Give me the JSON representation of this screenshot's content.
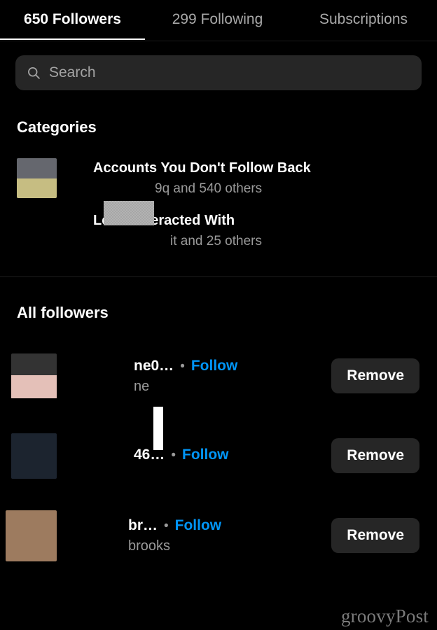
{
  "tabs": [
    {
      "label": "650 Followers",
      "active": true
    },
    {
      "label": "299 Following",
      "active": false
    },
    {
      "label": "Subscriptions",
      "active": false
    }
  ],
  "search": {
    "placeholder": "Search",
    "value": "",
    "icon": "search-icon"
  },
  "categories": {
    "title": "Categories",
    "items": [
      {
        "name": "Accounts You Don't Follow Back",
        "subtitle": "9q and 540 others",
        "avatar_top_color": "#65676e",
        "avatar_bottom_color": "#c6bd82"
      },
      {
        "name": "Least Interacted With",
        "subtitle": "it and 25 others",
        "avatar_top_color": "#65676e",
        "avatar_bottom_color": "#c6bd82"
      }
    ]
  },
  "all_followers": {
    "title": "All followers",
    "dot_separator": "•",
    "follow_label": "Follow",
    "remove_label": "Remove",
    "rows": [
      {
        "username": "ne0…",
        "fullname": "ne",
        "avatar_top_color": "#333333",
        "avatar_bottom_color": "#e4c0b8"
      },
      {
        "username": "46…",
        "fullname": "",
        "avatar_top_color": "#1c242f",
        "avatar_bottom_color": "#1c242f"
      },
      {
        "username": "br…",
        "fullname": "brooks",
        "avatar_top_color": "#9d7b5f",
        "avatar_bottom_color": "#9d7b5f"
      }
    ]
  },
  "watermark": "groovyPost",
  "colors": {
    "background": "#000000",
    "surface": "#262626",
    "accent_blue": "#0095f6",
    "text_primary": "#ffffff",
    "text_secondary": "#9a9a9a",
    "tab_inactive": "#a8a8a8"
  }
}
